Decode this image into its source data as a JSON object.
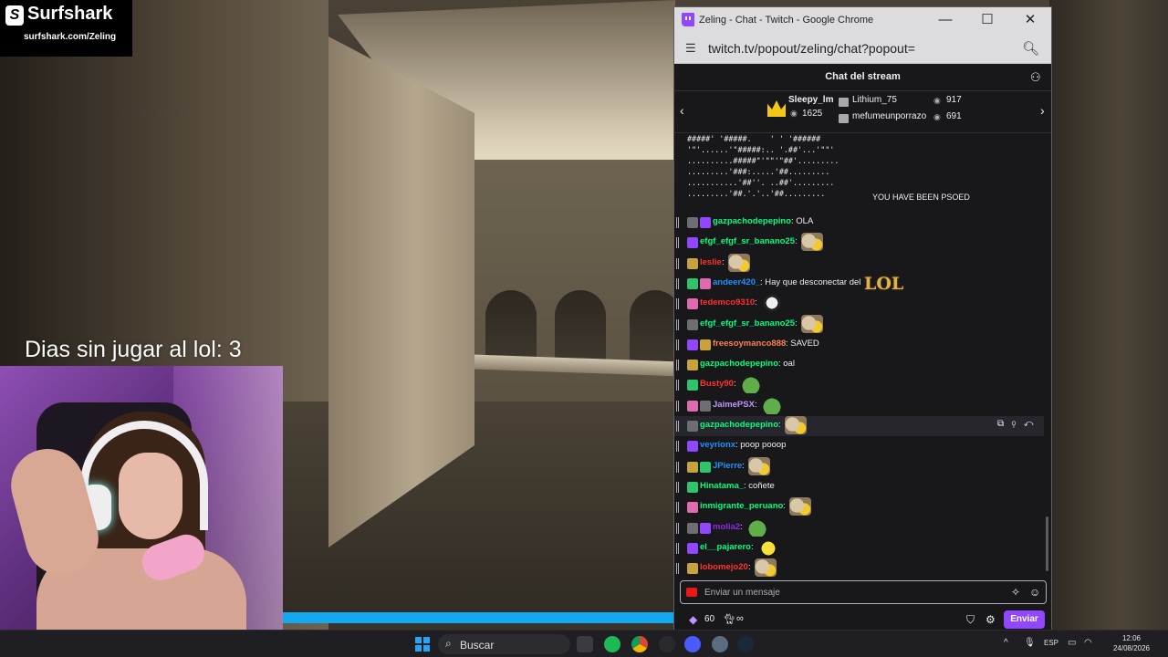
{
  "overlay": {
    "sponsor_name": "Surfshark",
    "sponsor_logo_letter": "S",
    "sponsor_url": "surfshark.com/Zeling",
    "counter_text": "Dias sin jugar al lol: 3",
    "video_progress": 0.51
  },
  "window": {
    "title": "Zeling - Chat - Twitch - Google Chrome",
    "minimize": "—",
    "maximize": "☐",
    "close": "✕",
    "url": "twitch.tv/popout/zeling/chat?popout=",
    "site_info_icon": "tune-icon",
    "zoom_icon": "magnifier-icon"
  },
  "chat": {
    "header_title": "Chat del stream",
    "leaderboard": {
      "top_name": "Sleepy_lm",
      "top_count": "1625",
      "entries": [
        {
          "name": "Lithium_75",
          "count": "917"
        },
        {
          "name": "mefumeunporrazo",
          "count": "691"
        }
      ]
    },
    "ascii_art": "#####' '#####.    ' ' '######\n'\"'......'\"#####:.. '.##'...'\"\"'\n..........#####\"'\"\"'\"##'.........\n.........'###:.....'##.........\n...........'##''. ..##'.........\n.........'##.'.'..'##.........",
    "ascii_tail": "YOU HAVE BEEN PSOED",
    "messages": [
      {
        "user": "gazpachodepepino",
        "color": "#00ff7f",
        "text": ": OLA"
      },
      {
        "user": "efgf_efgf_sr_banano25",
        "color": "#00ff7f",
        "text": ":"
      },
      {
        "user": "leslie",
        "color": "#ff3030",
        "text": ":"
      },
      {
        "user": "andeer420_",
        "color": "#1e90ff",
        "text": ": Hay que desconectar del"
      },
      {
        "user": "tedemco9310",
        "color": "#ff3030",
        "text": ":"
      },
      {
        "user": "efgf_efgf_sr_banano25",
        "color": "#00ff7f",
        "text": ":"
      },
      {
        "user": "freesoymanco888",
        "color": "#ff7f50",
        "text": ": SAVED"
      },
      {
        "user": "gazpachodepepino",
        "color": "#00ff7f",
        "text": ": oal"
      },
      {
        "user": "Busty90",
        "color": "#ff3030",
        "text": ":"
      },
      {
        "user": "JaimePSX",
        "color": "#bf94ff",
        "text": ":"
      },
      {
        "user": "gazpachodepepino",
        "color": "#00ff7f",
        "text": ":"
      },
      {
        "user": "veyrionx",
        "color": "#1e90ff",
        "text": ": poop pooop"
      },
      {
        "user": "JPierre",
        "color": "#1e90ff",
        "text": ":"
      },
      {
        "user": "Hinatama_",
        "color": "#00ff7f",
        "text": ": coñete"
      },
      {
        "user": "inmigrante_peruano",
        "color": "#00ff7f",
        "text": ":"
      },
      {
        "user": "molia2",
        "color": "#8a2be2",
        "text": ":"
      },
      {
        "user": "el__pajarero",
        "color": "#00ff7f",
        "text": ":"
      },
      {
        "user": "lobomejo20",
        "color": "#ff3030",
        "text": ":"
      }
    ],
    "emote_lol": "LOL",
    "input_placeholder": "Enviar un mensaje",
    "points": "60",
    "points_suffix": "∞",
    "send_label": "Enviar"
  },
  "taskbar": {
    "search_label": "Buscar",
    "lang": "ESP",
    "time": "12:06",
    "date": "24/08/2026"
  }
}
